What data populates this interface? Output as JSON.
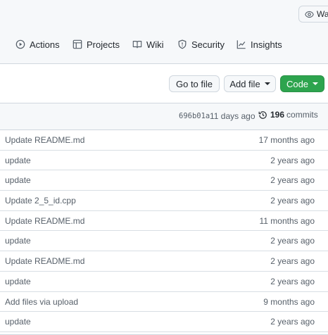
{
  "header": {
    "watch_label": "Watc",
    "tabs": [
      {
        "label": "Actions",
        "icon": "play-icon"
      },
      {
        "label": "Projects",
        "icon": "table-icon"
      },
      {
        "label": "Wiki",
        "icon": "book-icon"
      },
      {
        "label": "Security",
        "icon": "shield-icon"
      },
      {
        "label": "Insights",
        "icon": "graph-icon"
      }
    ]
  },
  "toolbar": {
    "go_to_file": "Go to file",
    "add_file": "Add file",
    "code": "Code",
    "code_color": "#2da44e"
  },
  "latest_commit": {
    "sha": "696b01a",
    "ago": "11 days ago",
    "commit_count": "196",
    "commits_label": "commits"
  },
  "files": [
    {
      "message": "Update README.md",
      "age": "17 months ago"
    },
    {
      "message": "update",
      "age": "2 years ago"
    },
    {
      "message": "update",
      "age": "2 years ago"
    },
    {
      "message": "Update 2_5_id.cpp",
      "age": "2 years ago"
    },
    {
      "message": "Update README.md",
      "age": "11 months ago"
    },
    {
      "message": "update",
      "age": "2 years ago"
    },
    {
      "message": "Update README.md",
      "age": "2 years ago"
    },
    {
      "message": "update",
      "age": "2 years ago"
    },
    {
      "message": "Add files via upload",
      "age": "9 months ago"
    },
    {
      "message": "update",
      "age": "2 years ago"
    }
  ]
}
